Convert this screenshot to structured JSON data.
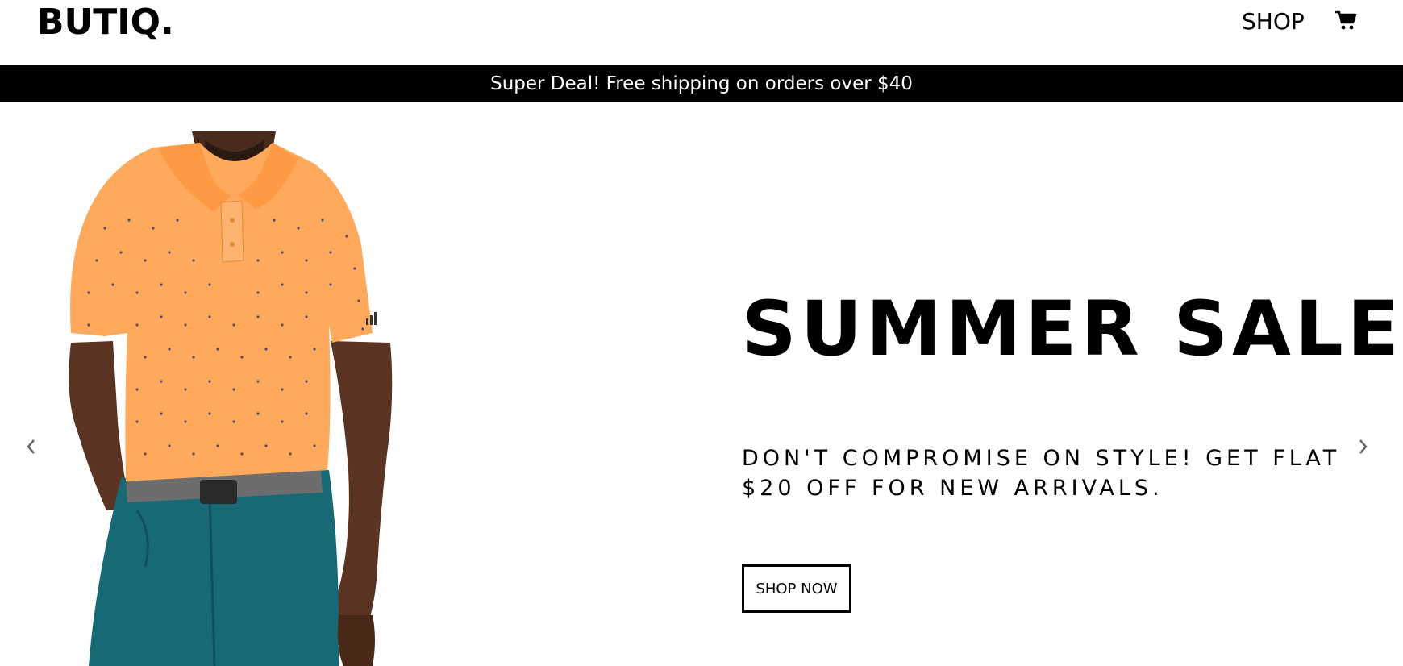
{
  "navbar": {
    "logo": "BUTIQ.",
    "shop_link": "SHOP",
    "cart_icon": "shopping-cart-icon"
  },
  "promo_bar": {
    "text": "Super Deal! Free shipping on orders over $40"
  },
  "hero": {
    "title": "SUMMER SALE.",
    "subtitle": "DON'T COMPROMISE ON STYLE! GET FLAT $20 OFF FOR NEW ARRIVALS.",
    "cta_label": "SHOP NOW",
    "prev_icon": "chevron-left-icon",
    "next_icon": "chevron-right-icon",
    "image": "man-in-orange-polo-shirt-photo"
  },
  "colors": {
    "background": "#ffffff",
    "promo_bar_bg": "#000000",
    "promo_bar_text": "#ffffff",
    "text": "#000000",
    "shirt": "#ffa95c",
    "shorts": "#176a75"
  }
}
